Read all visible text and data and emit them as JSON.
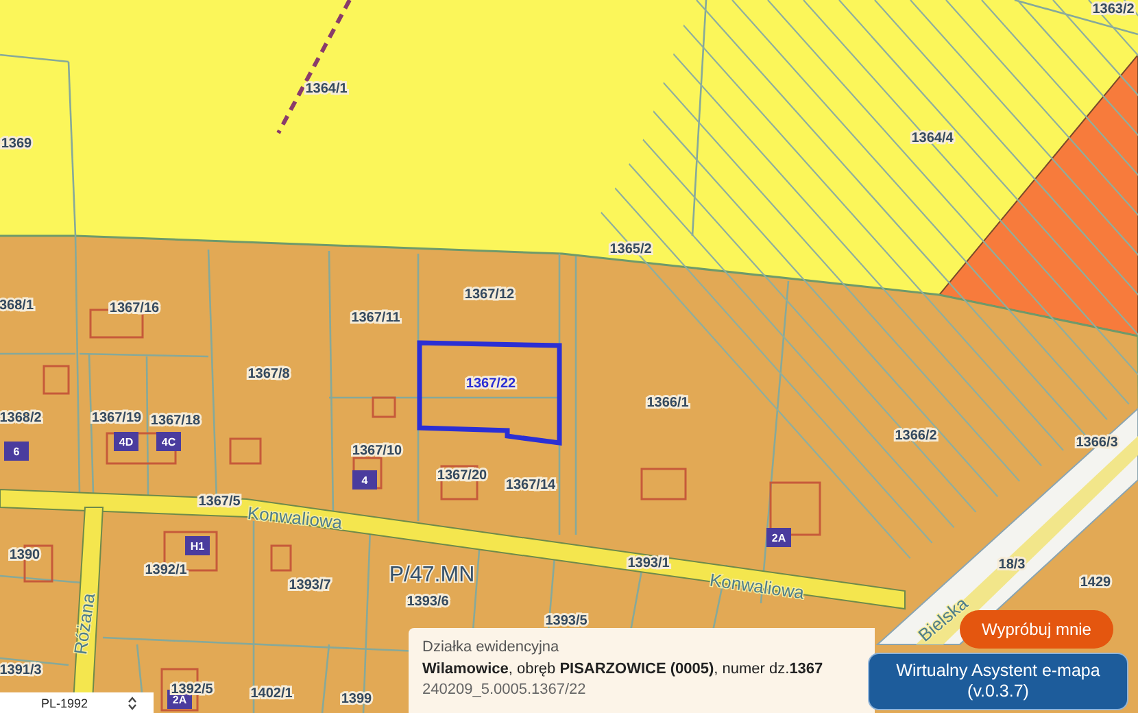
{
  "map": {
    "parcels": [
      {
        "number": "1363/2",
        "selected": false
      },
      {
        "number": "1364/1",
        "selected": false
      },
      {
        "number": "1369",
        "selected": false
      },
      {
        "number": "1364/4",
        "selected": false
      },
      {
        "number": "1365/2",
        "selected": false
      },
      {
        "number": "368/1",
        "selected": false
      },
      {
        "number": "1367/16",
        "selected": false
      },
      {
        "number": "1367/11",
        "selected": false
      },
      {
        "number": "1367/12",
        "selected": false
      },
      {
        "number": "1367/8",
        "selected": false
      },
      {
        "number": "1367/22",
        "selected": true
      },
      {
        "number": "1368/2",
        "selected": false
      },
      {
        "number": "1367/19",
        "selected": false
      },
      {
        "number": "1367/18",
        "selected": false
      },
      {
        "number": "1367/10",
        "selected": false
      },
      {
        "number": "1367/20",
        "selected": false
      },
      {
        "number": "1367/14",
        "selected": false
      },
      {
        "number": "1366/1",
        "selected": false
      },
      {
        "number": "1366/2",
        "selected": false
      },
      {
        "number": "1366/3",
        "selected": false
      },
      {
        "number": "1367/5",
        "selected": false
      },
      {
        "number": "1390",
        "selected": false
      },
      {
        "number": "1392/1",
        "selected": false
      },
      {
        "number": "1393/1",
        "selected": false
      },
      {
        "number": "18/3",
        "selected": false
      },
      {
        "number": "1429",
        "selected": false
      },
      {
        "number": "1393/7",
        "selected": false
      },
      {
        "number": "1393/6",
        "selected": false
      },
      {
        "number": "1393/5",
        "selected": false
      },
      {
        "number": "1391/3",
        "selected": false
      },
      {
        "number": "1392/5",
        "selected": false
      },
      {
        "number": "1402/1",
        "selected": false
      },
      {
        "number": "1399",
        "selected": false
      }
    ],
    "zone_labels": [
      "P/47.MN"
    ],
    "street_names": [
      "Konwaliowa",
      "Konwaliowa",
      "Różana",
      "Bielska"
    ],
    "building_numbers": [
      "4D",
      "4C",
      "6",
      "4",
      "2A",
      "H1",
      "2A"
    ]
  },
  "parcel_info": {
    "title": "Działka ewidencyjna",
    "description": "**Wilamowice**, obręb **PISARZOWICE (0005)**, numer dz.**1367**",
    "identifier": "240209_5.0005.1367/22"
  },
  "assistant": {
    "prompt": "Wypróbuj mnie",
    "title": "Wirtualny Asystent e-mapa",
    "version": "(v.0.3.7)"
  },
  "projection_select": {
    "value": "PL-1992"
  }
}
